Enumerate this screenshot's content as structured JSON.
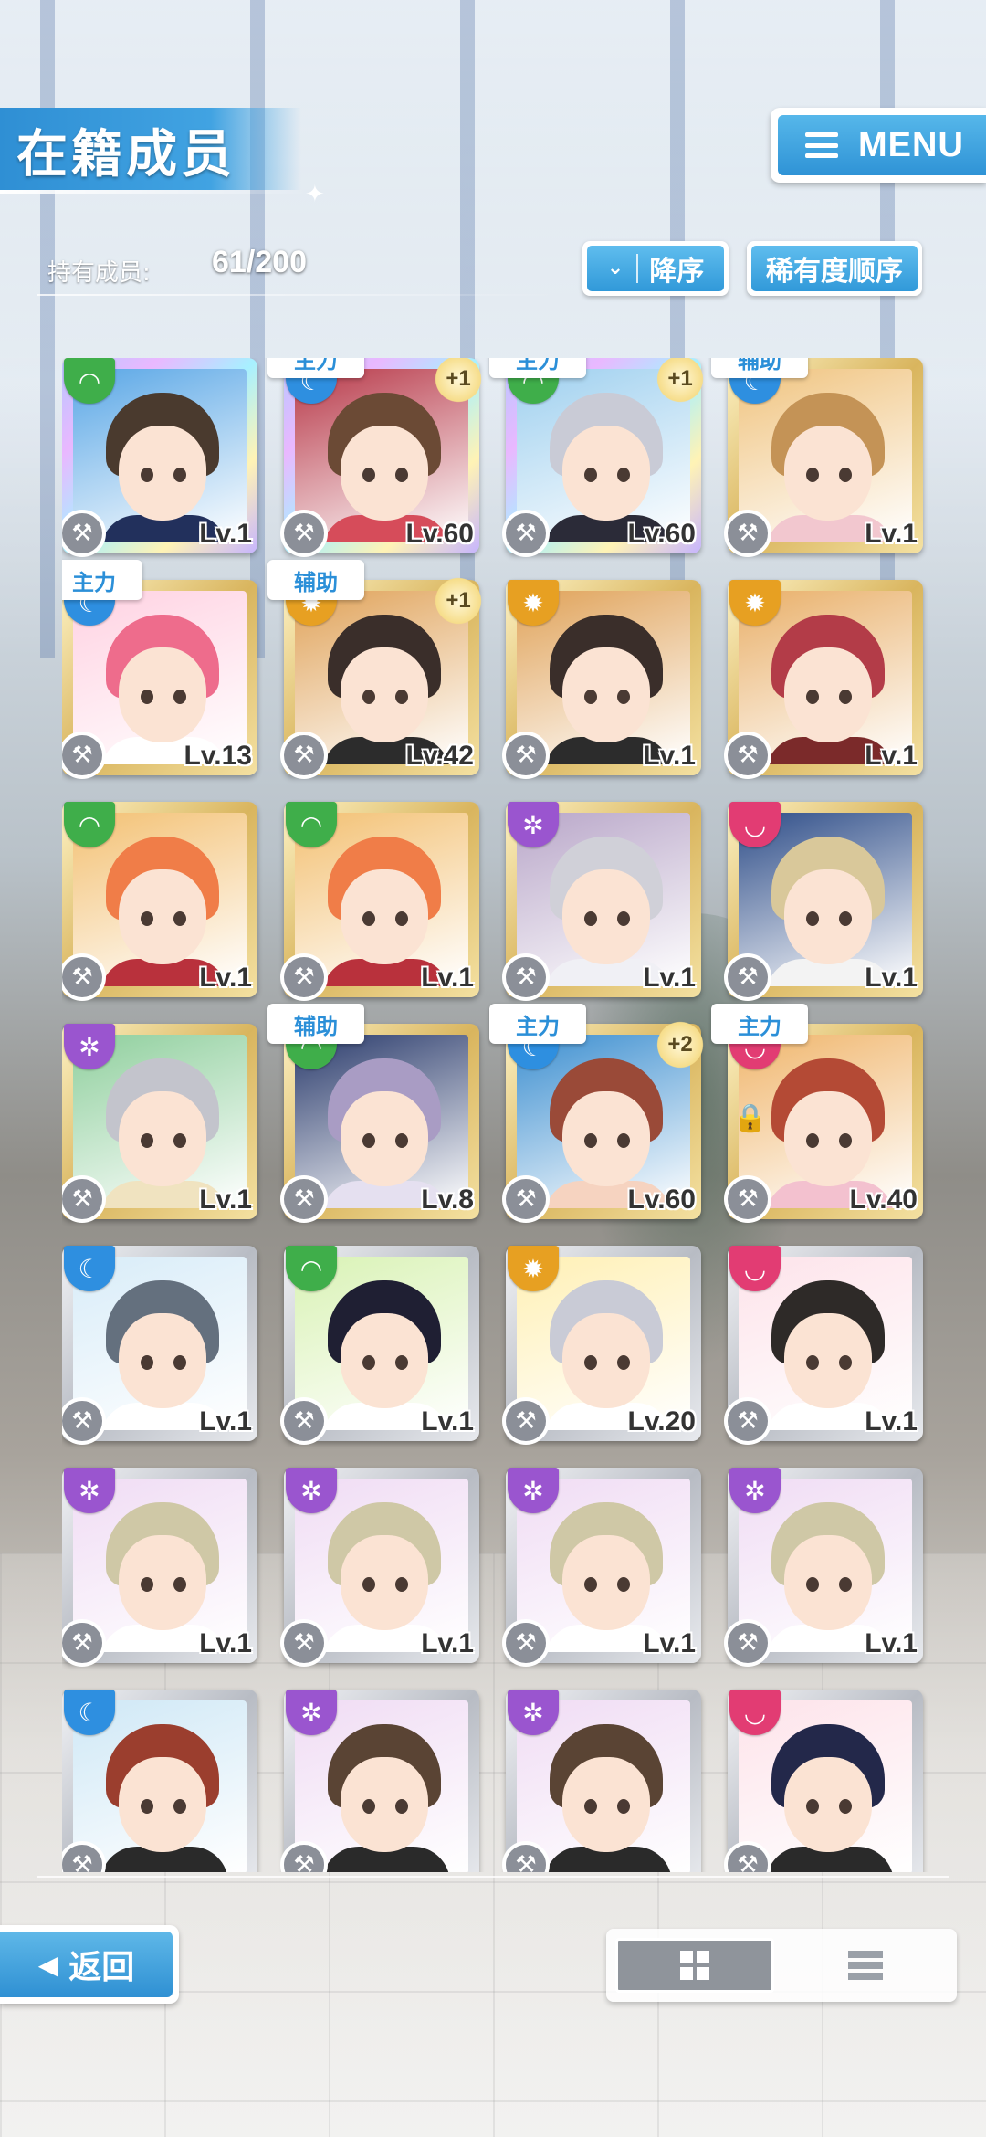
{
  "header": {
    "title": "在籍成员",
    "menu_label": "MENU"
  },
  "members": {
    "count_label": "持有成员:",
    "count_value": "61/200"
  },
  "sort": {
    "order_label": "降序",
    "rarity_label": "稀有度顺序"
  },
  "cards": [
    {
      "attr": "green",
      "frame": "rainbow",
      "role": "",
      "plus": "",
      "level": "Lv.1",
      "hair": "#4a3a2e",
      "bg": "#5aa7e6",
      "body": "#22305c"
    },
    {
      "attr": "blue",
      "frame": "rainbow",
      "role": "主力",
      "plus": "+1",
      "level": "Lv.60",
      "hair": "#6b4a35",
      "bg": "#b83a4a",
      "body": "#d64c5a"
    },
    {
      "attr": "green",
      "frame": "rainbow",
      "role": "主力",
      "plus": "+1",
      "level": "Lv.60",
      "hair": "#c9cbd6",
      "bg": "#9fd0ef",
      "body": "#2b2b38"
    },
    {
      "attr": "blue",
      "frame": "gold",
      "role": "辅助",
      "plus": "",
      "level": "Lv.1",
      "hair": "#c49356",
      "bg": "#f0c480",
      "body": "#f2c7cf"
    },
    {
      "attr": "blue",
      "frame": "gold",
      "role": "主力",
      "plus": "",
      "level": "Lv.13",
      "hair": "#ee6c8c",
      "bg": "#ffd2e2",
      "body": "#ffffff"
    },
    {
      "attr": "orange",
      "frame": "gold",
      "role": "辅助",
      "plus": "+1",
      "level": "Lv.42",
      "hair": "#3a2e2a",
      "bg": "#e0a35a",
      "body": "#2c2c2c"
    },
    {
      "attr": "orange",
      "frame": "gold",
      "role": "",
      "plus": "",
      "level": "Lv.1",
      "hair": "#3a2e2a",
      "bg": "#e0a35a",
      "body": "#2c2c2c"
    },
    {
      "attr": "orange",
      "frame": "gold",
      "role": "",
      "plus": "",
      "level": "Lv.1",
      "hair": "#b33c48",
      "bg": "#e9b06a",
      "body": "#7b2a2a"
    },
    {
      "attr": "green",
      "frame": "gold",
      "role": "",
      "plus": "",
      "level": "Lv.1",
      "hair": "#f07d48",
      "bg": "#f3c174",
      "body": "#b9313c"
    },
    {
      "attr": "green",
      "frame": "gold",
      "role": "",
      "plus": "",
      "level": "Lv.1",
      "hair": "#f07d48",
      "bg": "#f3c174",
      "body": "#b9313c"
    },
    {
      "attr": "purple",
      "frame": "gold",
      "role": "",
      "plus": "",
      "level": "Lv.1",
      "hair": "#d0d0d8",
      "bg": "#b9a7c9",
      "body": "#f0f0f5"
    },
    {
      "attr": "pink",
      "frame": "gold",
      "role": "",
      "plus": "",
      "level": "Lv.1",
      "hair": "#d9c89a",
      "bg": "#2f4e89",
      "body": "#f3f3f3"
    },
    {
      "attr": "purple",
      "frame": "gold",
      "role": "",
      "plus": "",
      "level": "Lv.1",
      "hair": "#c3c4cc",
      "bg": "#8fcf9d",
      "body": "#f0e3c0"
    },
    {
      "attr": "green",
      "frame": "gold",
      "role": "辅助",
      "plus": "",
      "level": "Lv.8",
      "hair": "#a99cc4",
      "bg": "#2a3b6c",
      "body": "#e5e0f0"
    },
    {
      "attr": "blue",
      "frame": "gold",
      "role": "主力",
      "plus": "+2",
      "level": "Lv.60",
      "hair": "#9a4a38",
      "bg": "#3d8fd0",
      "body": "#f6d3c0"
    },
    {
      "attr": "pink",
      "frame": "gold",
      "role": "主力",
      "plus": "",
      "level": "Lv.40",
      "hair": "#b44a35",
      "bg": "#f0b66d",
      "body": "#f3c1cf"
    },
    {
      "attr": "blue",
      "frame": "silver",
      "role": "",
      "plus": "",
      "level": "Lv.1",
      "hair": "#64707e",
      "bg": "#d8ecf8",
      "body": "#ffffff"
    },
    {
      "attr": "green",
      "frame": "silver",
      "role": "",
      "plus": "",
      "level": "Lv.1",
      "hair": "#1f1f33",
      "bg": "#d9f2b5",
      "body": "#ffffff"
    },
    {
      "attr": "orange",
      "frame": "silver",
      "role": "",
      "plus": "",
      "level": "Lv.20",
      "hair": "#c9cbd6",
      "bg": "#fff0b5",
      "body": "#ffffff"
    },
    {
      "attr": "pink",
      "frame": "silver",
      "role": "",
      "plus": "",
      "level": "Lv.1",
      "hair": "#2e2a28",
      "bg": "#fde3ea",
      "body": "#ffffff"
    },
    {
      "attr": "purple",
      "frame": "silver",
      "role": "",
      "plus": "",
      "level": "Lv.1",
      "hair": "#cfc8a6",
      "bg": "#f0dcf4",
      "body": "#ffffff"
    },
    {
      "attr": "purple",
      "frame": "silver",
      "role": "",
      "plus": "",
      "level": "Lv.1",
      "hair": "#cfc8a6",
      "bg": "#f0dcf4",
      "body": "#ffffff"
    },
    {
      "attr": "purple",
      "frame": "silver",
      "role": "",
      "plus": "",
      "level": "Lv.1",
      "hair": "#cfc8a6",
      "bg": "#f0dcf4",
      "body": "#ffffff"
    },
    {
      "attr": "purple",
      "frame": "silver",
      "role": "",
      "plus": "",
      "level": "Lv.1",
      "hair": "#cfc8a6",
      "bg": "#f0dcf4",
      "body": "#ffffff"
    },
    {
      "attr": "blue",
      "frame": "silver",
      "role": "",
      "plus": "",
      "level": "",
      "hair": "#9b3e2e",
      "bg": "#cfe8f6",
      "body": "#2a2a2a"
    },
    {
      "attr": "purple",
      "frame": "silver",
      "role": "",
      "plus": "",
      "level": "",
      "hair": "#5a4434",
      "bg": "#f0dcf4",
      "body": "#2a2a2a"
    },
    {
      "attr": "purple",
      "frame": "silver",
      "role": "",
      "plus": "",
      "level": "",
      "hair": "#5a4434",
      "bg": "#f0dcf4",
      "body": "#2a2a2a"
    },
    {
      "attr": "pink",
      "frame": "silver",
      "role": "",
      "plus": "",
      "level": "",
      "hair": "#23284a",
      "bg": "#fde3ea",
      "body": "#2a2a2a"
    }
  ],
  "footer": {
    "back_label": "返回"
  }
}
